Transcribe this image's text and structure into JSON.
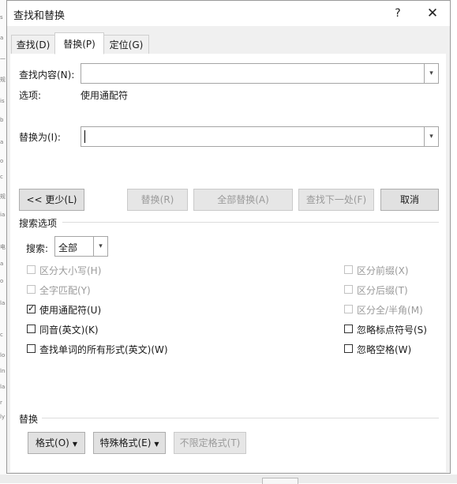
{
  "dialog": {
    "title": "查找和替换",
    "help_label": "?",
    "close_label": "✕"
  },
  "tabs": [
    {
      "label": "查找(D)",
      "active": false
    },
    {
      "label": "替换(P)",
      "active": true
    },
    {
      "label": "定位(G)",
      "active": false
    }
  ],
  "find": {
    "label": "查找内容(N):",
    "value": "",
    "options_label": "选项:",
    "options_value": "使用通配符"
  },
  "replace": {
    "label": "替换为(I):",
    "value": ""
  },
  "buttons": {
    "less": "<< 更少(L)",
    "replace": "替换(R)",
    "replace_all": "全部替换(A)",
    "find_next": "查找下一处(F)",
    "cancel": "取消"
  },
  "search_options": {
    "title": "搜索选项",
    "search_label": "搜索:",
    "search_value": "全部",
    "left": [
      {
        "label": "区分大小写(H)",
        "checked": false,
        "disabled": true
      },
      {
        "label": "全字匹配(Y)",
        "checked": false,
        "disabled": true
      },
      {
        "label": "使用通配符(U)",
        "checked": true,
        "disabled": false
      },
      {
        "label": "同音(英文)(K)",
        "checked": false,
        "disabled": false
      },
      {
        "label": "查找单词的所有形式(英文)(W)",
        "checked": false,
        "disabled": false
      }
    ],
    "right": [
      {
        "label": "区分前缀(X)",
        "checked": false,
        "disabled": true
      },
      {
        "label": "区分后缀(T)",
        "checked": false,
        "disabled": true
      },
      {
        "label": "区分全/半角(M)",
        "checked": false,
        "disabled": true
      },
      {
        "label": "忽略标点符号(S)",
        "checked": false,
        "disabled": false
      },
      {
        "label": "忽略空格(W)",
        "checked": false,
        "disabled": false
      }
    ]
  },
  "replace_section": {
    "title": "替换",
    "format": "格式(O)",
    "special": "特殊格式(E)",
    "no_format": "不限定格式(T)"
  },
  "icons": {
    "dropdown": "chevron-down-icon",
    "check": "checkmark-icon",
    "close": "close-icon",
    "help": "help-icon"
  }
}
